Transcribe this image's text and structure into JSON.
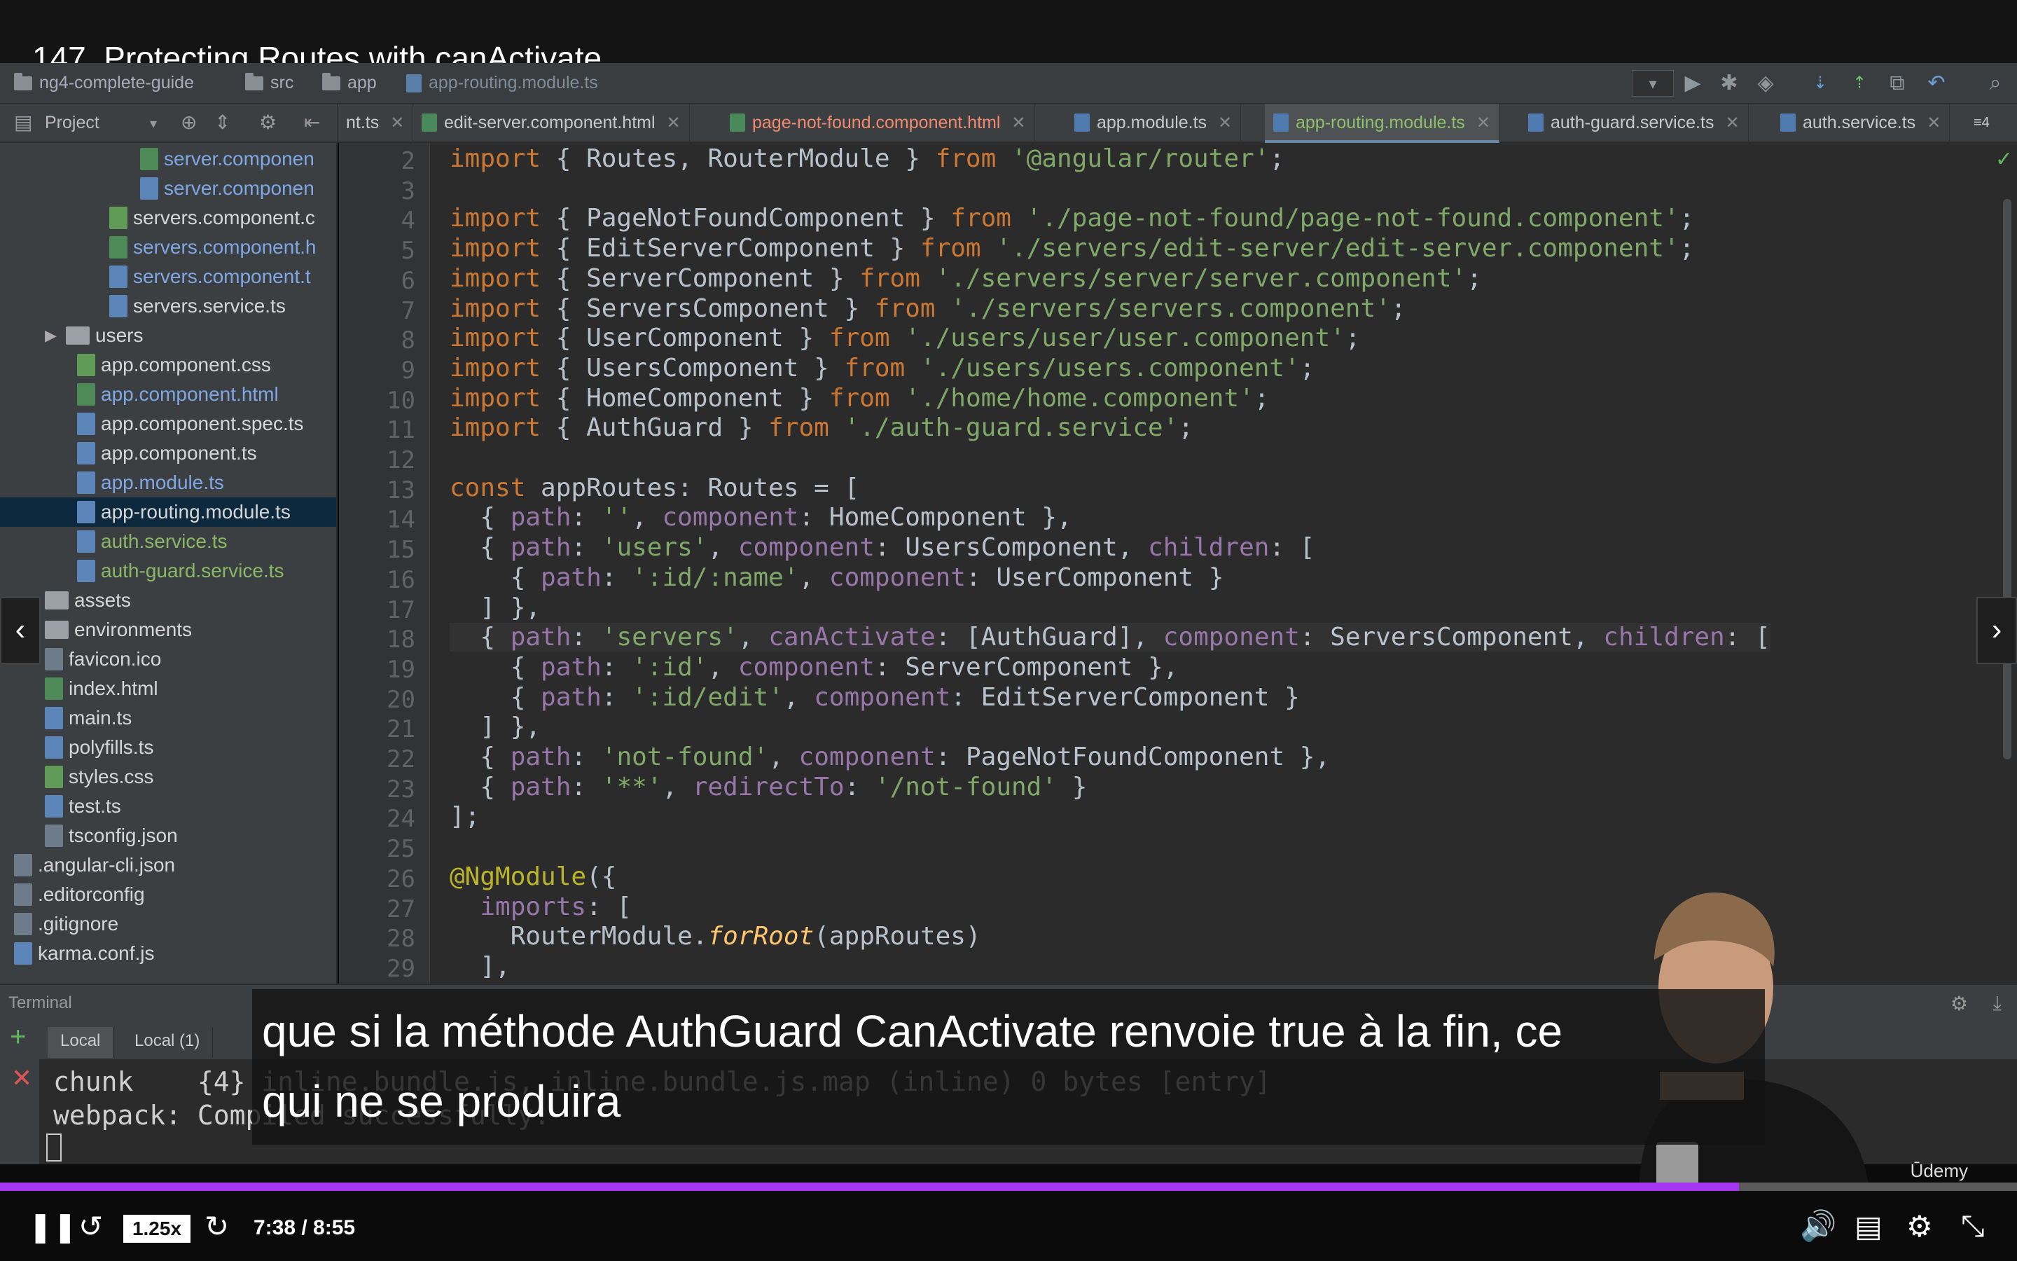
{
  "video": {
    "title": "147. Protecting Routes with canActivate",
    "caption_line1": "que si la méthode AuthGuard CanActivate renvoie true à la fin, ce",
    "caption_line2": "qui ne se produira",
    "speed": "1.25x",
    "time": "7:38 / 8:55",
    "progress": 0.862,
    "watermark": "Ūdemy"
  },
  "ide": {
    "breadcrumbs": [
      "ng4-complete-guide",
      "src",
      "app",
      "app-routing.module.ts"
    ],
    "project_label": "Project",
    "tabs": [
      {
        "label": "nt.ts",
        "kind": "ts"
      },
      {
        "label": "edit-server.component.html",
        "kind": "html"
      },
      {
        "label": "page-not-found.component.html",
        "kind": "html"
      },
      {
        "label": "app.module.ts",
        "kind": "ts"
      },
      {
        "label": "app-routing.module.ts",
        "kind": "ts"
      },
      {
        "label": "auth-guard.service.ts",
        "kind": "ts"
      },
      {
        "label": "auth.service.ts",
        "kind": "ts"
      }
    ],
    "tab_overflow": "≡4",
    "tree": [
      {
        "label": "server.componen",
        "type": "html",
        "color": "blue"
      },
      {
        "label": "server.componen",
        "type": "ts",
        "color": "blue"
      },
      {
        "label": "servers.component.c",
        "type": "css",
        "color": "white"
      },
      {
        "label": "servers.component.h",
        "type": "html",
        "color": "blue"
      },
      {
        "label": "servers.component.t",
        "type": "ts",
        "color": "blue"
      },
      {
        "label": "servers.service.ts",
        "type": "ts",
        "color": "white"
      },
      {
        "label": "users",
        "type": "folder",
        "color": "white"
      },
      {
        "label": "app.component.css",
        "type": "css",
        "color": "white"
      },
      {
        "label": "app.component.html",
        "type": "html",
        "color": "blue"
      },
      {
        "label": "app.component.spec.ts",
        "type": "ts",
        "color": "white"
      },
      {
        "label": "app.component.ts",
        "type": "ts",
        "color": "white"
      },
      {
        "label": "app.module.ts",
        "type": "ts",
        "color": "blue"
      },
      {
        "label": "app-routing.module.ts",
        "type": "ts",
        "color": "white"
      },
      {
        "label": "auth.service.ts",
        "type": "ts",
        "color": "green"
      },
      {
        "label": "auth-guard.service.ts",
        "type": "ts",
        "color": "green"
      },
      {
        "label": "assets",
        "type": "folder",
        "color": "white"
      },
      {
        "label": "environments",
        "type": "folder",
        "color": "white"
      },
      {
        "label": "favicon.ico",
        "type": "ico",
        "color": "white"
      },
      {
        "label": "index.html",
        "type": "html",
        "color": "white"
      },
      {
        "label": "main.ts",
        "type": "ts",
        "color": "white"
      },
      {
        "label": "polyfills.ts",
        "type": "ts",
        "color": "white"
      },
      {
        "label": "styles.css",
        "type": "css",
        "color": "white"
      },
      {
        "label": "test.ts",
        "type": "ts",
        "color": "white"
      },
      {
        "label": "tsconfig.json",
        "type": "json",
        "color": "white"
      },
      {
        ".angular-cli.json": "",
        "label": ".angular-cli.json",
        "type": "json",
        "color": "white"
      },
      {
        "label": ".editorconfig",
        "type": "cfg",
        "color": "white"
      },
      {
        "label": ".gitignore",
        "type": "git",
        "color": "white"
      },
      {
        "label": "karma.conf.js",
        "type": "js",
        "color": "white"
      }
    ],
    "line_numbers": [
      "2",
      "3",
      "4",
      "5",
      "6",
      "7",
      "8",
      "9",
      "10",
      "11",
      "12",
      "13",
      "14",
      "15",
      "16",
      "17",
      "18",
      "19",
      "20",
      "21",
      "22",
      "23",
      "24",
      "25",
      "26",
      "27",
      "28",
      "29"
    ],
    "code": [
      "import { Routes, RouterModule } from '@angular/router';",
      "",
      "import { PageNotFoundComponent } from './page-not-found/page-not-found.component';",
      "import { EditServerComponent } from './servers/edit-server/edit-server.component';",
      "import { ServerComponent } from './servers/server/server.component';",
      "import { ServersComponent } from './servers/servers.component';",
      "import { UserComponent } from './users/user/user.component';",
      "import { UsersComponent } from './users/users.component';",
      "import { HomeComponent } from './home/home.component';",
      "import { AuthGuard } from './auth-guard.service';",
      "",
      "const appRoutes: Routes = [",
      "  { path: '', component: HomeComponent },",
      "  { path: 'users', component: UsersComponent, children: [",
      "    { path: ':id/:name', component: UserComponent }",
      "  ] },",
      "  { path: 'servers', canActivate: [AuthGuard], component: ServersComponent, children: [",
      "    { path: ':id', component: ServerComponent },",
      "    { path: ':id/edit', component: EditServerComponent }",
      "  ] },",
      "  { path: 'not-found', component: PageNotFoundComponent },",
      "  { path: '**', redirectTo: '/not-found' }",
      "];",
      "",
      "@NgModule({",
      "  imports: [",
      "    RouterModule.forRoot(appRoutes)",
      "  ],"
    ],
    "terminal": {
      "label": "Terminal",
      "tabs": [
        "Local",
        "Local (1)"
      ],
      "line1": "chunk    {4} inline.bundle.js, inline.bundle.js.map (inline) 0 bytes [entry]",
      "line2": "webpack: Compiled successfully."
    }
  },
  "colors": {
    "accent": "#a435f0",
    "keyword": "#cc7832",
    "string": "#7fa869",
    "property": "#9876aa"
  }
}
